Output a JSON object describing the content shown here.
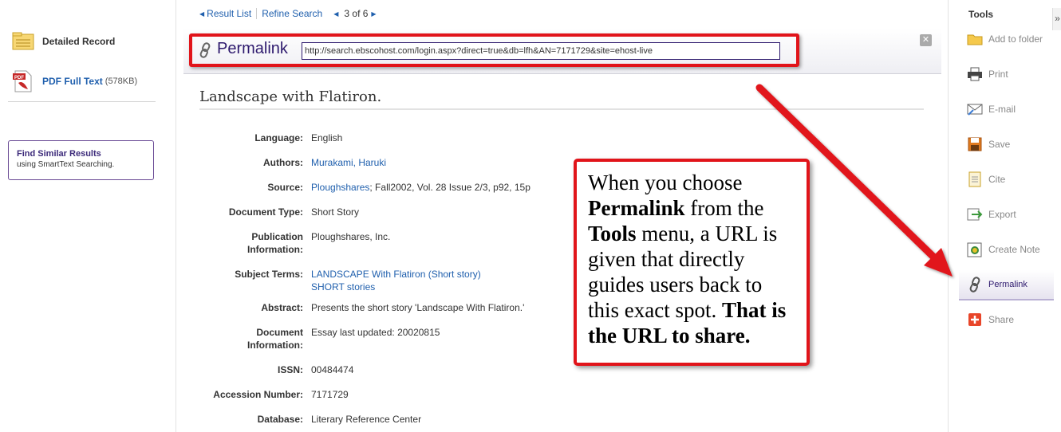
{
  "left": {
    "detailed_record": "Detailed Record",
    "pdf_full_text": "PDF Full Text",
    "pdf_size": "(578KB)",
    "find_similar_title": "Find Similar Results",
    "find_similar_sub": "using SmartText Searching."
  },
  "nav": {
    "result_list": "Result List",
    "refine_search": "Refine Search",
    "position": "3 of 6"
  },
  "permalink": {
    "title": "Permalink",
    "url": "http://search.ebscohost.com/login.aspx?direct=true&db=lfh&AN=7171729&site=ehost-live"
  },
  "record": {
    "title": "Landscape with Flatiron.",
    "fields": {
      "language_label": "Language:",
      "language": "English",
      "authors_label": "Authors:",
      "authors": "Murakami, Haruki",
      "source_label": "Source:",
      "source_link": "Ploughshares",
      "source_rest": "; Fall2002, Vol. 28 Issue 2/3, p92, 15p",
      "doctype_label": "Document Type:",
      "doctype": "Short Story",
      "pubinfo_label_1": "Publication",
      "pubinfo_label_2": "Information:",
      "pubinfo": "Ploughshares, Inc.",
      "subject_label": "Subject Terms:",
      "subject_1": "LANDSCAPE With Flatiron (Short story)",
      "subject_2": "SHORT stories",
      "abstract_label": "Abstract:",
      "abstract": "Presents the short story 'Landscape With Flatiron.'",
      "docinfo_label_1": "Document",
      "docinfo_label_2": "Information:",
      "docinfo": "Essay last updated: 20020815",
      "issn_label": "ISSN:",
      "issn": "00484474",
      "accession_label": "Accession Number:",
      "accession": "7171729",
      "database_label": "Database:",
      "database": "Literary Reference Center"
    }
  },
  "tools": {
    "heading": "Tools",
    "collapse": "»",
    "items": [
      {
        "label": "Add to folder",
        "icon": "folder-icon"
      },
      {
        "label": "Print",
        "icon": "printer-icon"
      },
      {
        "label": "E-mail",
        "icon": "email-icon"
      },
      {
        "label": "Save",
        "icon": "save-icon"
      },
      {
        "label": "Cite",
        "icon": "cite-icon"
      },
      {
        "label": "Export",
        "icon": "export-icon"
      },
      {
        "label": "Create Note",
        "icon": "note-icon"
      },
      {
        "label": "Permalink",
        "icon": "link-icon"
      },
      {
        "label": "Share",
        "icon": "share-icon"
      }
    ]
  },
  "callout": {
    "p1": "When you choose",
    "b1": "Permalink",
    "p2": " from the",
    "b2": "Tools",
    "p3": " menu, a URL is given that directly guides users back to this exact spot. ",
    "b3": "That is the URL to share."
  },
  "colors": {
    "accent_red": "#e1141a",
    "link_blue": "#1f5fad",
    "brand_purple": "#2e1a6e"
  }
}
